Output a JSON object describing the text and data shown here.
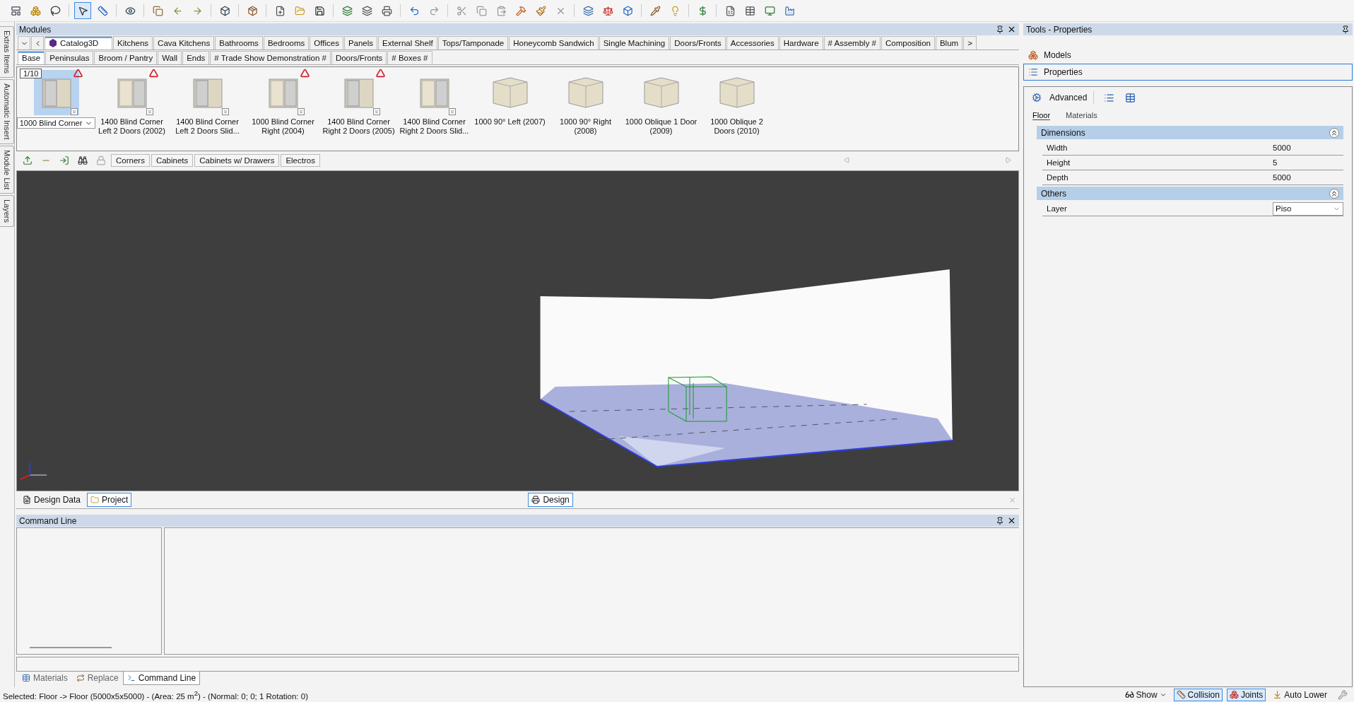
{
  "side_tabs": [
    {
      "label": "Extras Items",
      "selected": false
    },
    {
      "label": "Automatic Insert",
      "selected": false
    },
    {
      "label": "Module List",
      "selected": false
    },
    {
      "label": "Layers",
      "selected": false
    }
  ],
  "modules": {
    "title": "Modules",
    "category_tabs": [
      {
        "label": "Catalog3D",
        "selected": true
      },
      {
        "label": "Kitchens",
        "selected": false
      },
      {
        "label": "Cava Kitchens",
        "selected": false
      },
      {
        "label": "Bathrooms",
        "selected": false
      },
      {
        "label": "Bedrooms",
        "selected": false
      },
      {
        "label": "Offices",
        "selected": false
      },
      {
        "label": "Panels",
        "selected": false
      },
      {
        "label": "External Shelf",
        "selected": false
      },
      {
        "label": "Tops/Tamponade",
        "selected": false
      },
      {
        "label": "Honeycomb Sandwich",
        "selected": false
      },
      {
        "label": "Single Machining",
        "selected": false
      },
      {
        "label": "Doors/Fronts",
        "selected": false
      },
      {
        "label": "Accessories",
        "selected": false
      },
      {
        "label": "Hardware",
        "selected": false
      },
      {
        "label": "# Assembly #",
        "selected": false
      },
      {
        "label": "Composition",
        "selected": false
      },
      {
        "label": "Blum",
        "selected": false
      }
    ],
    "more_tabs": ">",
    "sub_tabs": [
      {
        "label": "Base",
        "selected": true
      },
      {
        "label": "Peninsulas",
        "selected": false
      },
      {
        "label": "Broom / Pantry",
        "selected": false
      },
      {
        "label": "Wall",
        "selected": false
      },
      {
        "label": "Ends",
        "selected": false
      },
      {
        "label": "# Trade Show Demonstration #",
        "selected": false
      },
      {
        "label": "Doors/Fronts",
        "selected": false
      },
      {
        "label": "# Boxes #",
        "selected": false
      }
    ],
    "page_counter": "1/10",
    "items": [
      {
        "label": "1000 Blind Corner",
        "selected": true,
        "flagged": true,
        "expandable": true
      },
      {
        "label": "1400 Blind Corner Left 2 Doors (2002)",
        "selected": false,
        "flagged": true,
        "expandable": true
      },
      {
        "label": "1400 Blind Corner Left 2 Doors Slid...",
        "selected": false,
        "flagged": false,
        "expandable": true
      },
      {
        "label": "1000 Blind Corner Right (2004)",
        "selected": false,
        "flagged": true,
        "expandable": true
      },
      {
        "label": "1400 Blind Corner Right 2 Doors (2005)",
        "selected": false,
        "flagged": true,
        "expandable": true
      },
      {
        "label": "1400 Blind Corner Right 2 Doors Slid...",
        "selected": false,
        "flagged": false,
        "expandable": true
      },
      {
        "label": "1000 90° Left (2007)",
        "selected": false,
        "flagged": false,
        "expandable": false
      },
      {
        "label": "1000 90° Right (2008)",
        "selected": false,
        "flagged": false,
        "expandable": false
      },
      {
        "label": "1000 Oblique 1 Door (2009)",
        "selected": false,
        "flagged": false,
        "expandable": false
      },
      {
        "label": "1000 Oblique 2 Doors (2010)",
        "selected": false,
        "flagged": false,
        "expandable": false
      }
    ],
    "group_tabs": [
      {
        "label": "Corners",
        "selected": false
      },
      {
        "label": "Cabinets",
        "selected": false
      },
      {
        "label": "Cabinets w/ Drawers",
        "selected": false
      },
      {
        "label": "Electros",
        "selected": false
      }
    ]
  },
  "document_tabs": [
    {
      "label": "Design Data",
      "selected": false
    },
    {
      "label": "Project",
      "selected": true
    }
  ],
  "view_tabs": [
    {
      "label": "Design",
      "selected": true
    }
  ],
  "command_line": {
    "title": "Command Line"
  },
  "bottom_tabs": [
    {
      "label": "Materials",
      "selected": false
    },
    {
      "label": "Replace",
      "selected": false
    },
    {
      "label": "Command Line",
      "selected": true
    }
  ],
  "status_bar": {
    "text": "Selected: Floor -> Floor (5000x5x5000) - (Area: 25 m$^{2}$) - (Normal: 0; 0; 1 Rotation: 0)",
    "toggles": [
      {
        "label": "Show",
        "on": false,
        "kind": "dropdown"
      },
      {
        "label": "Collision",
        "on": true,
        "kind": "toggle"
      },
      {
        "label": "Joints",
        "on": true,
        "kind": "toggle"
      },
      {
        "label": "Auto Lower",
        "on": false,
        "kind": "toggle"
      }
    ]
  },
  "tools_panel": {
    "title": "Tools - Properties",
    "nav": [
      {
        "label": "Models",
        "selected": false
      },
      {
        "label": "Properties",
        "selected": true
      }
    ],
    "mode": "Advanced",
    "object_tabs": [
      {
        "label": "Floor",
        "selected": true
      },
      {
        "label": "Materials",
        "selected": false
      }
    ],
    "groups": [
      {
        "title": "Dimensions",
        "expanded": true,
        "rows": [
          {
            "name": "Width",
            "value": "5000",
            "kind": "text"
          },
          {
            "name": "Height",
            "value": "5",
            "kind": "text"
          },
          {
            "name": "Depth",
            "value": "5000",
            "kind": "text"
          }
        ]
      },
      {
        "title": "Others",
        "expanded": true,
        "rows": [
          {
            "name": "Layer",
            "value": "Piso",
            "kind": "select"
          }
        ]
      }
    ]
  }
}
